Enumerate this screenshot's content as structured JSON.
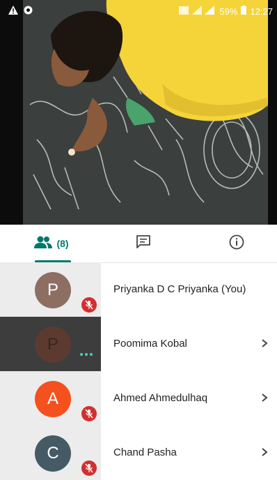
{
  "status_bar": {
    "battery": "59%",
    "time": "12:27"
  },
  "tabs": [
    {
      "icon": "people-icon",
      "count": "(8)",
      "active": true
    },
    {
      "icon": "chat-icon"
    },
    {
      "icon": "info-icon"
    }
  ],
  "participants": [
    {
      "initial": "P",
      "name": "Priyanka D C Priyanka (You)",
      "avatar_color": "#8d6e63",
      "status": "muted",
      "chevron": false
    },
    {
      "initial": "P",
      "name": "Poomima Kobal",
      "avatar_color": "#5d3a30",
      "status": "speaking",
      "chevron": true
    },
    {
      "initial": "A",
      "name": "Ahmed Ahmedulhaq",
      "avatar_color": "#f4511e",
      "status": "muted",
      "chevron": true
    },
    {
      "initial": "C",
      "name": "Chand Pasha",
      "avatar_color": "#455a64",
      "status": "muted",
      "chevron": true
    }
  ],
  "colors": {
    "accent": "#00796b",
    "mute": "#d32f2f",
    "active_row": "#3d3d3d"
  }
}
